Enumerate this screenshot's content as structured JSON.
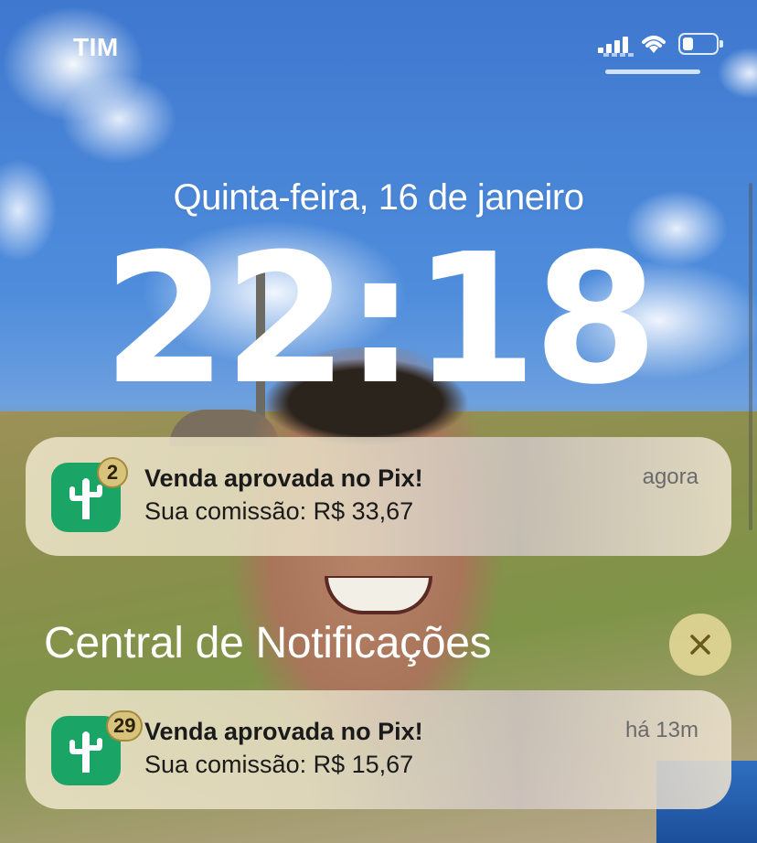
{
  "status_bar": {
    "carrier": "TIM",
    "signal_icon": "cellular-signal-icon",
    "wifi_icon": "wifi-icon",
    "battery_icon": "battery-icon",
    "battery_level": 0.3
  },
  "lock_screen": {
    "date": "Quinta-feira, 16 de janeiro",
    "time": "22:18"
  },
  "notifications": [
    {
      "app_icon": "cactus-icon",
      "badge": "2",
      "title": "Venda aprovada no Pix!",
      "body": "Sua comissão: R$ 33,67",
      "time": "agora"
    }
  ],
  "notification_center": {
    "title": "Central de Notificações",
    "clear_icon": "close-icon",
    "items": [
      {
        "app_icon": "cactus-icon",
        "badge": "29",
        "title": "Venda aprovada no Pix!",
        "body": "Sua comissão: R$ 15,67",
        "time": "há 13m"
      }
    ]
  },
  "colors": {
    "app_icon_bg": "#1aa567",
    "badge_bg": "#d8c37c",
    "clear_button_bg": "#e2d696"
  }
}
